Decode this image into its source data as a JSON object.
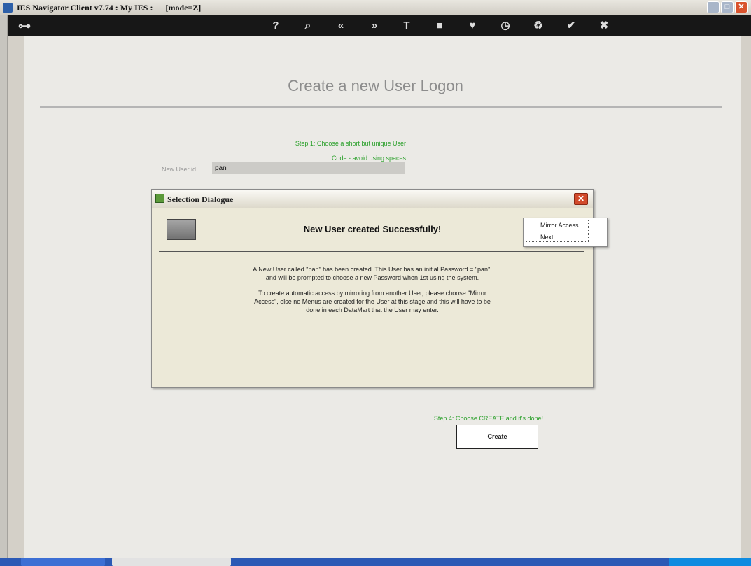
{
  "window": {
    "title": "IES Navigator Client v7.74 : My IES :      [mode=Z]",
    "controls": {
      "minimize": "_",
      "maximize": "□",
      "close": "✕"
    }
  },
  "toolbar": {
    "icons": [
      {
        "name": "key-icon",
        "glyph": "⊶"
      },
      {
        "name": "help-icon",
        "glyph": "?"
      },
      {
        "name": "search-icon",
        "glyph": "⌕"
      },
      {
        "name": "back-icon",
        "glyph": "«"
      },
      {
        "name": "forward-icon",
        "glyph": "»"
      },
      {
        "name": "text-size-icon",
        "glyph": "T"
      },
      {
        "name": "chip-icon",
        "glyph": "■"
      },
      {
        "name": "favorite-heart-icon",
        "glyph": "♥"
      },
      {
        "name": "clock-icon",
        "glyph": "◷"
      },
      {
        "name": "recycle-icon",
        "glyph": "♻"
      },
      {
        "name": "confirm-check-icon",
        "glyph": "✔"
      },
      {
        "name": "close-circle-icon",
        "glyph": "✖"
      }
    ]
  },
  "page": {
    "title": "Create a new User Logon",
    "step1_line1": "Step 1: Choose a short but unique User",
    "step1_line2": "Code - avoid using spaces",
    "new_user_id_label": "New User id",
    "new_user_id_value": "pan",
    "step4": "Step 4: Choose CREATE and it's done!",
    "create_button": "Create"
  },
  "dialog": {
    "title": "Selection Dialogue",
    "close": "✕",
    "heading": "New User created Successfully!",
    "message_line1": "A New User called \"pan\" has been created. This User has an initial Password = \"pan\",",
    "message_line2": "and will be prompted to choose a new Password when 1st using the system.",
    "message_line3": "To create automatic access by mirroring from another User, please choose \"Mirror",
    "message_line4": "Access\", else no Menus are created for the User at this stage,and this will have to be",
    "message_line5": "done in each DataMart that the User may enter.",
    "options": [
      "Mirror Access",
      "Next"
    ]
  },
  "colors": {
    "toolbar_bg": "#171717",
    "step_text": "#2aa02a",
    "page_title": "#8d8d8d",
    "close_red": "#d24a2b"
  }
}
